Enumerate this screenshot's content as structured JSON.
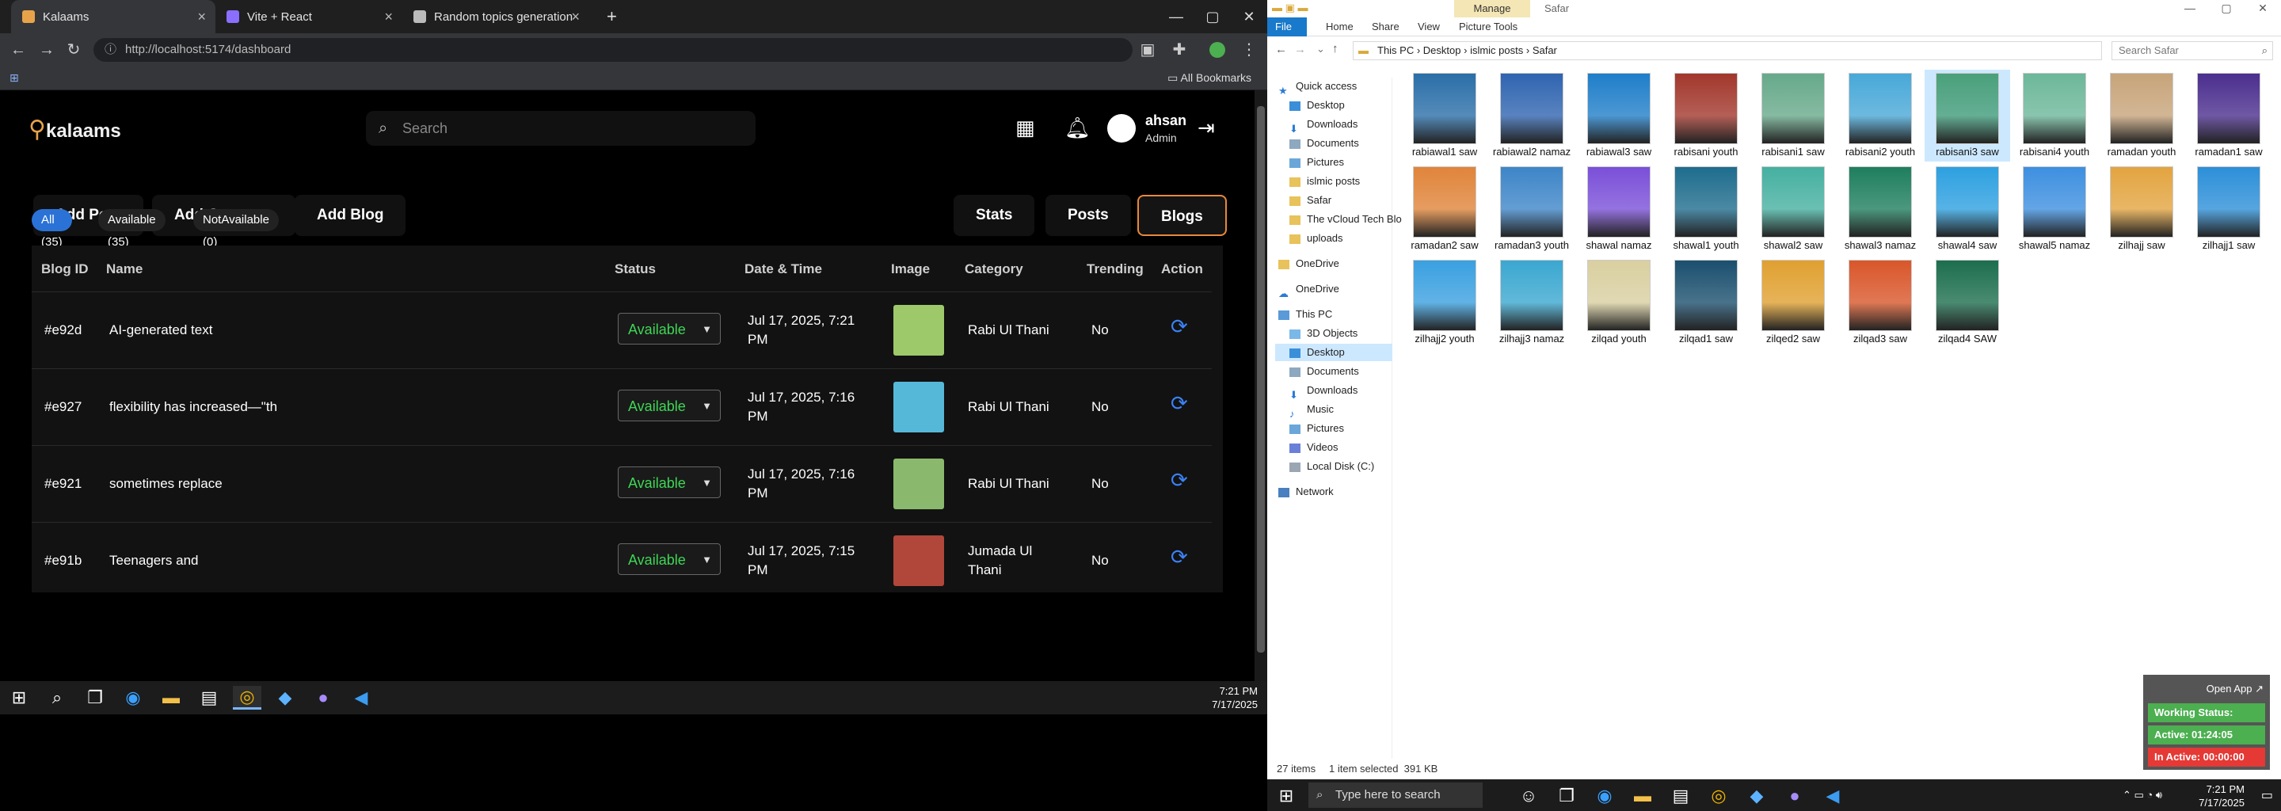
{
  "browser": {
    "tabs": [
      {
        "title": "Kalaams",
        "color": "#e8a34a"
      },
      {
        "title": "Vite + React",
        "color": "#8a6fff"
      },
      {
        "title": "Random topics generation",
        "color": "#bbbbbb"
      }
    ],
    "url": "http://localhost:5174/dashboard",
    "bookmarks_label": "All Bookmarks"
  },
  "app": {
    "brand": "kalaams",
    "search_placeholder": "Search",
    "user": {
      "name": "ahsan",
      "role": "Admin"
    },
    "toolbar": {
      "add_post": "Add Post",
      "add_category": "Add Category",
      "add_blog": "Add Blog",
      "stats": "Stats",
      "posts": "Posts",
      "blogs": "Blogs"
    },
    "filters": [
      "All (35)",
      "Available (35)",
      "NotAvailable (0)"
    ],
    "columns": [
      "Blog ID",
      "Name",
      "Status",
      "Date & Time",
      "Image",
      "Category",
      "Trending",
      "Action"
    ],
    "rows": [
      {
        "id": "#e92d",
        "name": "AI-generated text",
        "status": "Available",
        "date": "Jul 17, 2025, 7:21",
        "date2": "PM",
        "category": "Rabi Ul Thani",
        "category2": "",
        "trending": "No",
        "thumb": "#9dc96a"
      },
      {
        "id": "#e927",
        "name": "flexibility has increased—\"th",
        "status": "Available",
        "date": "Jul 17, 2025, 7:16",
        "date2": "PM",
        "category": "Rabi Ul Thani",
        "category2": "",
        "trending": "No",
        "thumb": "#56b8d9"
      },
      {
        "id": "#e921",
        "name": "sometimes replace",
        "status": "Available",
        "date": "Jul 17, 2025, 7:16",
        "date2": "PM",
        "category": "Rabi Ul Thani",
        "category2": "",
        "trending": "No",
        "thumb": "#8ab96d"
      },
      {
        "id": "#e91b",
        "name": "Teenagers and",
        "status": "Available",
        "date": "Jul 17, 2025, 7:15",
        "date2": "PM",
        "category": "Jumada Ul",
        "category2": "Thani",
        "trending": "No",
        "thumb": "#b0473a"
      }
    ]
  },
  "taskbar1": {
    "time": "7:21 PM",
    "date": "7/17/2025"
  },
  "explorer": {
    "title": "Safar",
    "manage": "Manage",
    "ribbon": [
      "File",
      "Home",
      "Share",
      "View",
      "Picture Tools"
    ],
    "path": [
      "This PC",
      "Desktop",
      "islmic posts",
      "Safar"
    ],
    "search_placeholder": "Search Safar",
    "nav": [
      "Quick access",
      "Desktop",
      "Downloads",
      "Documents",
      "Pictures",
      "islmic posts",
      "Safar",
      "The vCloud Tech Blo",
      "uploads",
      "OneDrive",
      "OneDrive",
      "This PC",
      "3D Objects",
      "Desktop",
      "Documents",
      "Downloads",
      "Music",
      "Pictures",
      "Videos",
      "Local Disk (C:)",
      "Network"
    ],
    "files": [
      {
        "name": "rabiawal1 saw",
        "c": "#2a6ea8"
      },
      {
        "name": "rabiawal2 namaz",
        "c": "#2f64b0"
      },
      {
        "name": "rabiawal3 saw",
        "c": "#1f7ec9"
      },
      {
        "name": "rabisani youth",
        "c": "#a2372c"
      },
      {
        "name": "rabisani1 saw",
        "c": "#67a98a"
      },
      {
        "name": "rabisani2 youth",
        "c": "#48a8d8"
      },
      {
        "name": "rabisani3 saw",
        "c": "#4aa07a"
      },
      {
        "name": "rabisani4 youth",
        "c": "#6cb79a"
      },
      {
        "name": "ramadan youth",
        "c": "#c7a47a"
      },
      {
        "name": "ramadan1 saw",
        "c": "#4b2e8e"
      },
      {
        "name": "ramadan2 saw",
        "c": "#e0843a"
      },
      {
        "name": "ramadan3 youth",
        "c": "#3d85c8"
      },
      {
        "name": "shawal namaz",
        "c": "#7a4fd8"
      },
      {
        "name": "shawal1 youth",
        "c": "#1e6c8d"
      },
      {
        "name": "shawal2 saw",
        "c": "#45b0a0"
      },
      {
        "name": "shawal3 namaz",
        "c": "#1e7e5e"
      },
      {
        "name": "shawal4 saw",
        "c": "#2da0e0"
      },
      {
        "name": "shawal5 namaz",
        "c": "#3d8fe0"
      },
      {
        "name": "zilhajj saw",
        "c": "#e3a440"
      },
      {
        "name": "zilhajj1 saw",
        "c": "#2c8fd8"
      },
      {
        "name": "zilhajj2 youth",
        "c": "#3aa0e0"
      },
      {
        "name": "zilhajj3 namaz",
        "c": "#3aa7d0"
      },
      {
        "name": "zilqad youth",
        "c": "#d9cfa0"
      },
      {
        "name": "zilqad1 saw",
        "c": "#1b4f6e"
      },
      {
        "name": "zilqed2 saw",
        "c": "#e0a030"
      },
      {
        "name": "zilqad3 saw",
        "c": "#d9562a"
      },
      {
        "name": "zilqad4 SAW",
        "c": "#1c6e4e"
      }
    ],
    "status": {
      "items": "27 items",
      "selected": "1 item selected  391 KB"
    }
  },
  "widget": {
    "open": "Open App ↗",
    "working": "Working Status: Active",
    "active": "Active: 01:24:05",
    "inactive": "In Active: 00:00:00"
  },
  "taskbar2": {
    "search": "Type here to search",
    "time": "7:21 PM",
    "date": "7/17/2025"
  }
}
